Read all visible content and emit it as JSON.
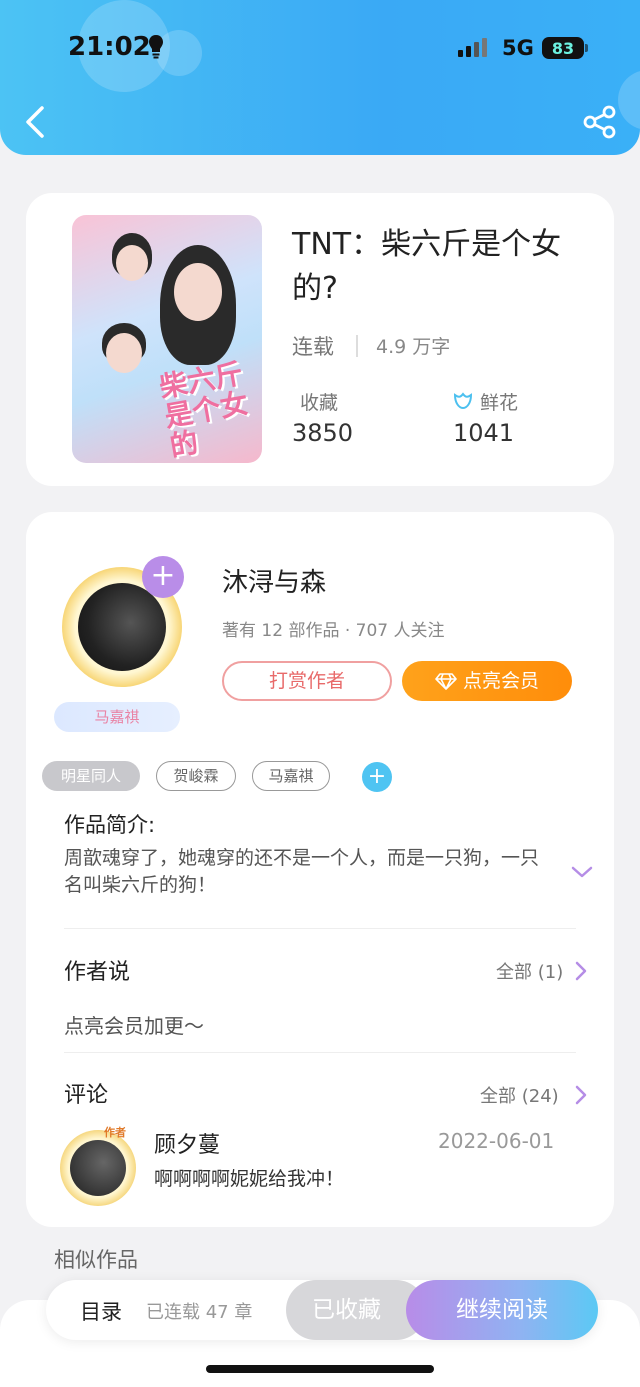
{
  "status_bar": {
    "time": "21:02",
    "network": "5G",
    "battery": "83"
  },
  "header": {
    "back_icon": "chevron-left-icon",
    "share_icon": "share-icon",
    "gradient_colors": [
      "#4cc3f4",
      "#3ab0f7"
    ]
  },
  "book": {
    "title": "TNT：柴六斤是个女的?",
    "status": "连载",
    "word_count": "4.9 万字",
    "stats": [
      {
        "label": "收藏",
        "value": "3850"
      },
      {
        "label": "鲜花",
        "value": "1041",
        "icon": "flower-icon"
      }
    ]
  },
  "author": {
    "name": "沐浔与森",
    "meta": "著有 12 部作品 · 707 人关注",
    "fan_tag": "马嘉祺",
    "tip_label": "打赏作者",
    "vip_label": "点亮会员",
    "vip_color": "#ff9710"
  },
  "tags": [
    "明星同人",
    "贺峻霖",
    "马嘉祺"
  ],
  "intro": {
    "title": "作品简介:",
    "text": "周歆魂穿了，她魂穿的还不是一个人，而是一只狗，一只名叫柴六斤的狗！"
  },
  "author_says": {
    "title": "作者说",
    "all_label": "全部 (1)",
    "text": "点亮会员加更～"
  },
  "comments": {
    "title": "评论",
    "all_label": "全部 (24)",
    "items": [
      {
        "name": "顾夕蔓",
        "date": "2022-06-01",
        "text": "啊啊啊啊妮妮给我冲！",
        "badge": "作者"
      }
    ]
  },
  "similar_title": "相似作品",
  "bottom_bar": {
    "toc_label": "目录",
    "chapters": "已连载 47 章",
    "collected_label": "已收藏",
    "read_label": "继续阅读"
  }
}
